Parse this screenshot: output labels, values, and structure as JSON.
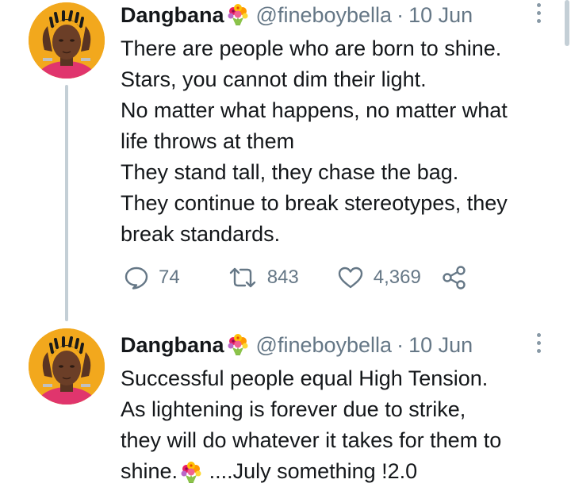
{
  "tweets": [
    {
      "author": {
        "name": "Dangbana",
        "name_emoji": "bouquet-emoji",
        "handle": "@fineboybella"
      },
      "separator": "·",
      "date": "10 Jun",
      "lines": [
        "There are people who are born to shine.",
        "Stars, you cannot dim their light.",
        "No matter what happens, no matter what",
        "life throws at them",
        "They stand tall, they chase the bag.",
        "They continue to break stereotypes, they",
        "break standards."
      ],
      "stats": {
        "replies": "74",
        "retweets": "843",
        "likes": "4,369"
      },
      "icons": [
        "reply-icon",
        "retweet-icon",
        "like-icon",
        "share-icon",
        "more-options-icon"
      ]
    },
    {
      "author": {
        "name": "Dangbana",
        "name_emoji": "bouquet-emoji",
        "handle": "@fineboybella"
      },
      "separator": "·",
      "date": "10 Jun",
      "lines": [
        "Successful people equal High Tension.",
        "As lightening is forever due to strike,",
        "they will do whatever it takes for them to"
      ],
      "last_line": {
        "before": "shine.",
        "emoji": "bouquet-emoji",
        "after": " ....July something !2.0"
      },
      "icons": [
        "more-options-icon"
      ]
    }
  ],
  "colors": {
    "text": "#14171a",
    "secondary": "#657786",
    "thread_line": "#c4cfd6",
    "avatar_bg": "#f2a81d"
  }
}
